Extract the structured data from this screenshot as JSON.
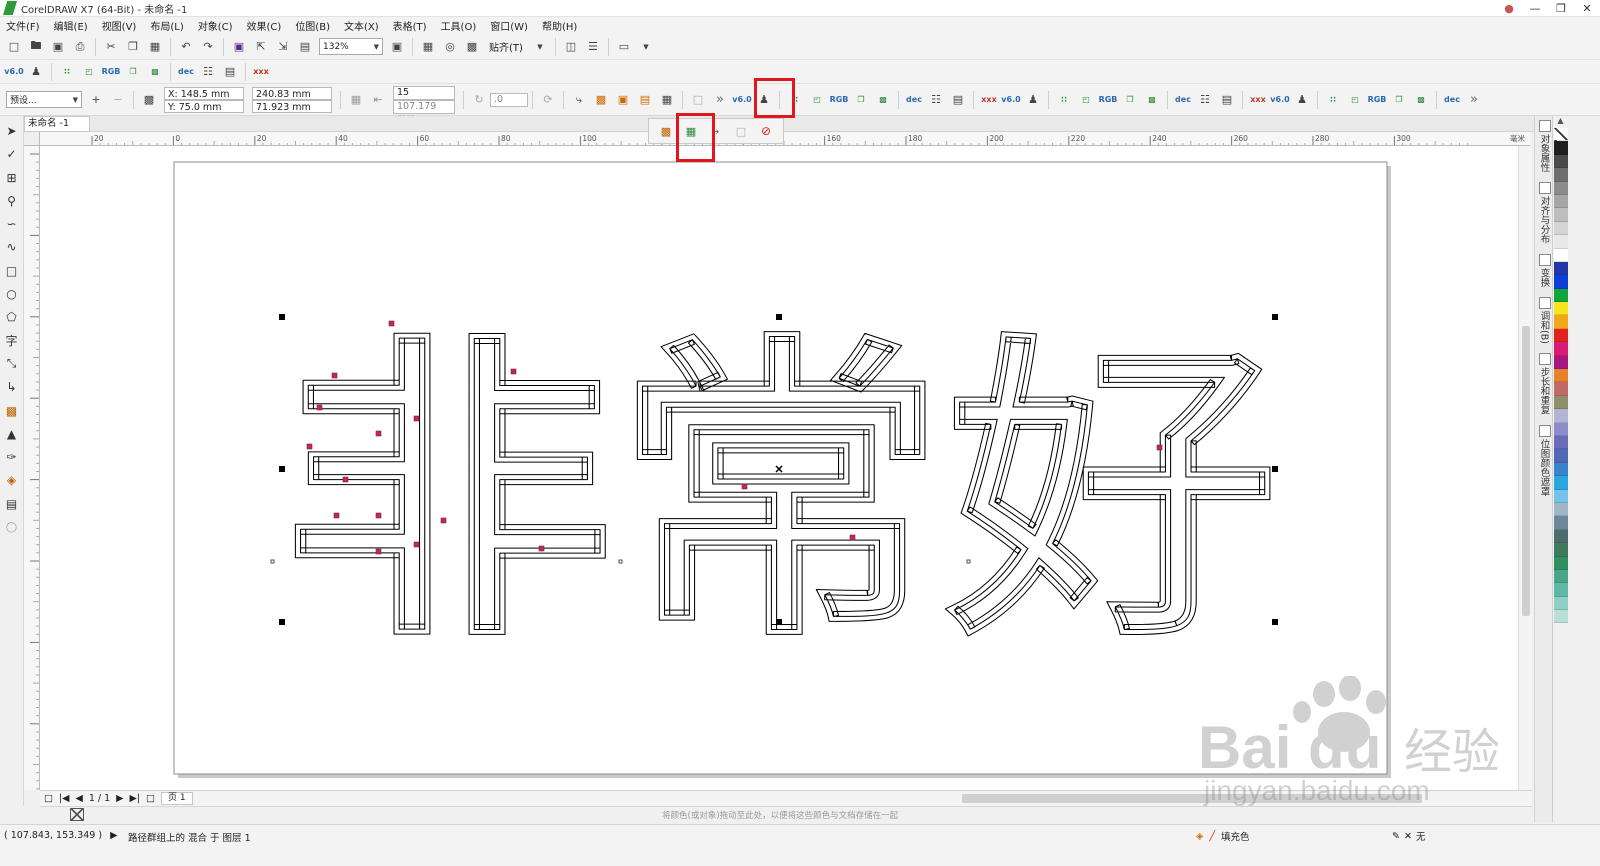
{
  "window": {
    "title": "CorelDRAW X7 (64-Bit) - 未命名 -1",
    "controls": [
      "minimize",
      "maximize",
      "close"
    ]
  },
  "menu": [
    "文件(F)",
    "编辑(E)",
    "视图(V)",
    "布局(L)",
    "对象(C)",
    "效果(C)",
    "位图(B)",
    "文本(X)",
    "表格(T)",
    "工具(O)",
    "窗口(W)",
    "帮助(H)"
  ],
  "toolbar1": {
    "zoom": "132%",
    "snap_label": "贴齐(T)"
  },
  "toolbar3": {
    "preset": "预设...",
    "x": "X: 148.5 mm",
    "y": "Y: 75.0 mm",
    "width": "240.83 mm",
    "height": "71.923 mm",
    "steps": "15",
    "spacing": "107.179 mm",
    "rotation": ".0"
  },
  "document": {
    "tab": "未命名 -1",
    "page_tab": "页 1",
    "page_counter": "1 / 1"
  },
  "artwork": {
    "text": "非常好"
  },
  "rulers": {
    "h_ticks": [
      "20",
      "0",
      "20",
      "40",
      "60",
      "80",
      "100",
      "120",
      "140",
      "160",
      "180",
      "200",
      "220",
      "240",
      "260",
      "280",
      "300",
      "毫米"
    ]
  },
  "color_bar_hint": "将颜色(或对象)拖动至此处，以便将这些颜色与文档存储在一起",
  "status": {
    "coords": "( 107.843, 153.349 )",
    "info": "路径群组上的 混合 于 图层 1",
    "fill": "填充色",
    "outline": "无"
  },
  "dockers": [
    "对象属性",
    "对齐与分布",
    "变换",
    "调和(B)",
    "步长和重复",
    "位图颜色遮罩"
  ],
  "palette": [
    "#1f1f1f",
    "#4a4a4a",
    "#6e6e6e",
    "#8c8c8c",
    "#a6a6a6",
    "#bdbdbd",
    "#d4d4d4",
    "#e8e8e8",
    "#ffffff",
    "#2436a8",
    "#0a3fd8",
    "#11a63b",
    "#f5e51b",
    "#f2a619",
    "#e3211c",
    "#d81b75",
    "#a71580",
    "#e8822a",
    "#c06a6a",
    "#8f8f6a",
    "#b3b3d6",
    "#8c8ccc",
    "#6b6bb8",
    "#4f67b5",
    "#3a82c9",
    "#2aa6e0",
    "#73c3e8",
    "#9fb6c6",
    "#6d879a",
    "#4c6b6b",
    "#3f7a5c",
    "#2f8f62",
    "#49a58a",
    "#60b7a4",
    "#8fcfc4",
    "#b8e0d5"
  ],
  "watermark": {
    "brand": "Bai  du",
    "cn": "经验",
    "url": "jingyan.baidu.com"
  },
  "accent": "#e0171d"
}
